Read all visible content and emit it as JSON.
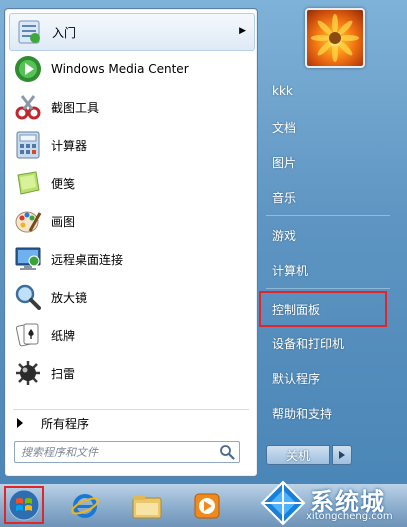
{
  "programs": [
    {
      "label": "入门",
      "icon": "getting-started-icon",
      "has_arrow": true
    },
    {
      "label": "Windows Media Center",
      "icon": "media-center-icon"
    },
    {
      "label": "截图工具",
      "icon": "snipping-tool-icon"
    },
    {
      "label": "计算器",
      "icon": "calculator-icon"
    },
    {
      "label": "便笺",
      "icon": "sticky-notes-icon"
    },
    {
      "label": "画图",
      "icon": "paint-icon"
    },
    {
      "label": "远程桌面连接",
      "icon": "remote-desktop-icon"
    },
    {
      "label": "放大镜",
      "icon": "magnifier-icon"
    },
    {
      "label": "纸牌",
      "icon": "solitaire-icon"
    },
    {
      "label": "扫雷",
      "icon": "minesweeper-icon"
    }
  ],
  "all_programs_label": "所有程序",
  "search": {
    "placeholder": "搜索程序和文件"
  },
  "right_items": [
    {
      "label": "kkk"
    },
    {
      "label": "文档"
    },
    {
      "label": "图片"
    },
    {
      "label": "音乐"
    },
    {
      "label": "游戏"
    },
    {
      "label": "计算机"
    },
    {
      "label": "控制面板",
      "highlighted": true
    },
    {
      "label": "设备和打印机"
    },
    {
      "label": "默认程序"
    },
    {
      "label": "帮助和支持"
    }
  ],
  "shutdown_label": "关机",
  "watermark": {
    "name": "系统城",
    "url": "xitongcheng.com"
  },
  "colors": {
    "highlight_box": "#e0252b",
    "panel_blue": "#5e95c2"
  }
}
